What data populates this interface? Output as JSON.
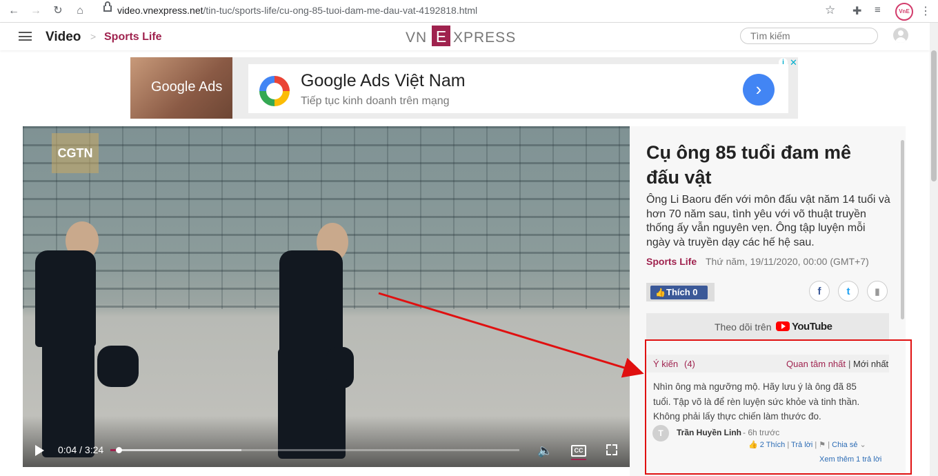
{
  "browser": {
    "url_host": "video.vnexpress.net",
    "url_path": "/tin-tuc/sports-life/cu-ong-85-tuoi-dam-me-dau-vat-4192818.html"
  },
  "header": {
    "section": "Video",
    "category": "Sports Life",
    "logo_left": "VN",
    "logo_box": "E",
    "logo_right": "XPRESS",
    "search_placeholder": "Tìm kiếm"
  },
  "ad": {
    "brand": "Google Ads",
    "title": "Google Ads Việt Nam",
    "subtitle": "Tiếp tục kinh doanh trên mạng",
    "arrow": "›",
    "info": "i",
    "close": "✕"
  },
  "video": {
    "watermark": "CGTN",
    "current_time": "0:04",
    "duration": "3:24",
    "progress_fraction": 0.02,
    "buffered_fraction": 0.32,
    "cc_label": "CC"
  },
  "article": {
    "title": "Cụ ông 85 tuổi đam mê đấu vật",
    "lead": "Ông Li Baoru đến với môn đấu vật năm 14 tuổi và hơn 70 năm sau, tình yêu với võ thuật truyền thống ấy vẫn nguyên vẹn. Ông tập luyện mỗi ngày và truyền dạy các hế hệ sau.",
    "category": "Sports Life",
    "date": "Thứ năm, 19/11/2020, 00:00 (GMT+7)",
    "like_label": "Thích 0",
    "follow_text": "Theo dõi trên",
    "youtube_label": "YouTube"
  },
  "comments": {
    "title": "Ý kiến",
    "count": "(4)",
    "sort_top": "Quan tâm nhất",
    "sort_sep": "|",
    "sort_new": "Mới nhất",
    "items": [
      {
        "text": "Nhìn ông mà ngưỡng mộ. Hãy lưu ý là ông đã 85 tuổi. Tập võ là để rèn luyện sức khỏe và tinh thần. Không phải lấy thực chiến làm thước đo.",
        "avatar_letter": "T",
        "author": "Trần Huyền Linh",
        "time": "- 6h trước",
        "likes": "2",
        "like_label": "Thích",
        "reply_label": "Trả lời",
        "share_label": "Chia sẻ",
        "more_replies": "Xem thêm 1 trả lời"
      }
    ]
  },
  "colors": {
    "brand": "#9f224e",
    "annotation": "#e01010",
    "facebook": "#3b5998",
    "link": "#2c6cb5"
  }
}
